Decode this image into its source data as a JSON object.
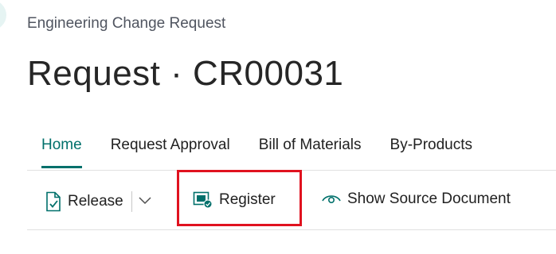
{
  "breadcrumb": "Engineering Change Request",
  "title": "Request · CR00031",
  "tabs": [
    {
      "label": "Home",
      "active": true
    },
    {
      "label": "Request Approval",
      "active": false
    },
    {
      "label": "Bill of Materials",
      "active": false
    },
    {
      "label": "By-Products",
      "active": false
    }
  ],
  "actions": {
    "release": {
      "label": "Release",
      "icon": "release-document-icon"
    },
    "release_more_icon": "chevron-down-icon",
    "register": {
      "label": "Register",
      "icon": "register-icon"
    },
    "show_source": {
      "label": "Show Source Document",
      "icon": "eye-icon"
    }
  },
  "colors": {
    "accent": "#00706b",
    "highlight": "#e0121f"
  }
}
